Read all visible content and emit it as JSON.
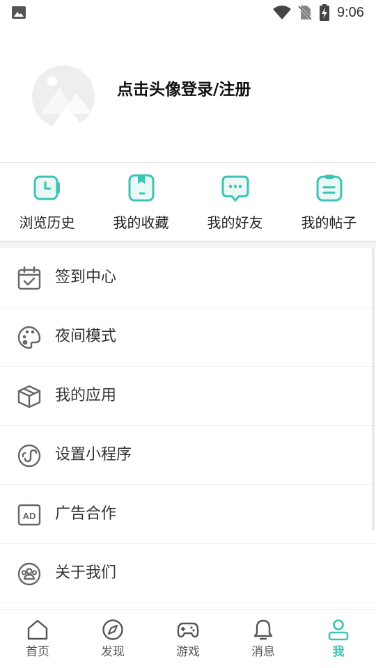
{
  "status_bar": {
    "time": "9:06",
    "icons": [
      "image-icon",
      "wifi-icon",
      "no-sim-icon",
      "battery-charging-icon"
    ]
  },
  "profile": {
    "avatar_icon": "avatar-placeholder-icon",
    "login_text": "点击头像登录/注册"
  },
  "quick_actions": [
    {
      "label": "浏览历史",
      "icon": "history-icon"
    },
    {
      "label": "我的收藏",
      "icon": "bookmark-icon"
    },
    {
      "label": "我的好友",
      "icon": "chat-bubble-icon"
    },
    {
      "label": "我的帖子",
      "icon": "clipboard-icon"
    }
  ],
  "menu": [
    {
      "label": "签到中心",
      "icon": "calendar-check-icon"
    },
    {
      "label": "夜间模式",
      "icon": "palette-icon"
    },
    {
      "label": "我的应用",
      "icon": "box-icon"
    },
    {
      "label": "设置小程序",
      "icon": "mini-program-icon"
    },
    {
      "label": "广告合作",
      "icon": "ad-icon"
    },
    {
      "label": "关于我们",
      "icon": "group-icon"
    }
  ],
  "bottom_nav": [
    {
      "label": "首页",
      "icon": "home-icon"
    },
    {
      "label": "发现",
      "icon": "compass-icon"
    },
    {
      "label": "游戏",
      "icon": "gamepad-icon"
    },
    {
      "label": "消息",
      "icon": "bell-icon"
    },
    {
      "label": "我",
      "icon": "user-icon",
      "active": true
    }
  ],
  "colors": {
    "accent": "#3cc3b5",
    "accent_light": "#eaf8f6",
    "icon_gray": "#666666",
    "text": "#333333"
  }
}
